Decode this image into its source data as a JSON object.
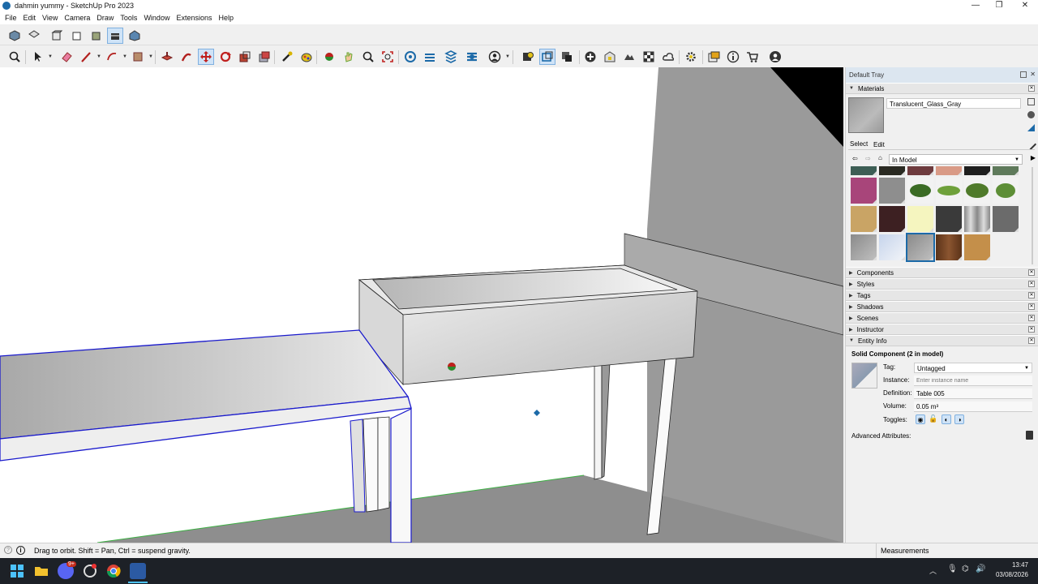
{
  "window": {
    "title": "dahmin yummy - SketchUp Pro 2023",
    "minimize_glyph": "—",
    "restore_glyph": "❐",
    "close_glyph": "✕"
  },
  "menu": [
    "File",
    "Edit",
    "View",
    "Camera",
    "Draw",
    "Tools",
    "Window",
    "Extensions",
    "Help"
  ],
  "tray": {
    "title": "Default Tray",
    "materials": {
      "header": "Materials",
      "current_name": "Translucent_Glass_Gray",
      "tab_select": "Select",
      "tab_edit": "Edit",
      "library": "In Model"
    },
    "collapsed_panels": [
      "Components",
      "Styles",
      "Tags",
      "Shadows",
      "Scenes",
      "Instructor"
    ],
    "entity_info": {
      "header": "Entity Info",
      "title": "Solid Component (2 in model)",
      "tag_label": "Tag:",
      "tag_value": "Untagged",
      "instance_label": "Instance:",
      "instance_placeholder": "Enter instance name",
      "definition_label": "Definition:",
      "definition_value": "Table 005",
      "volume_label": "Volume:",
      "volume_value": "0.05 m³",
      "toggles_label": "Toggles:",
      "advanced_label": "Advanced Attributes:"
    }
  },
  "status": {
    "hint": "Drag to orbit. Shift = Pan, Ctrl = suspend gravity.",
    "measurements_label": "Measurements"
  },
  "taskbar": {
    "time": "13:47",
    "date": "03/08/2026",
    "discord_badge": "9+"
  },
  "colors": {
    "accent": "#1c6aa8",
    "selection": "#1a1acc",
    "toolbar_active": "#cfe3f7"
  }
}
